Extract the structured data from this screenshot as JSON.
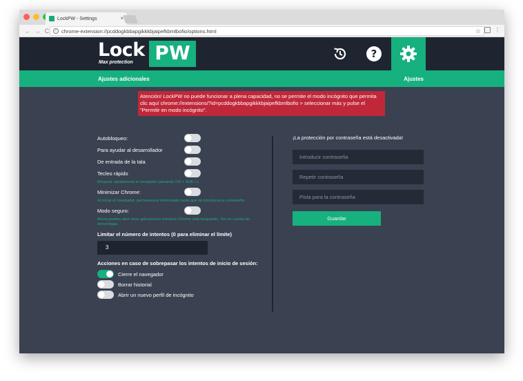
{
  "browser": {
    "tab_title": "LockPW - Settings",
    "tab_close": "×",
    "url": "chrome-extension://pcddogkbbapgikkkbjaipefkbmlbofio/options.html",
    "info": "i",
    "star": "☆",
    "menu": "⋮",
    "nav": {
      "back": "←",
      "forward": "→",
      "reload": "C"
    }
  },
  "header": {
    "logo_main": "Lock",
    "logo_sub": "Max protection",
    "logo_badge": "PW",
    "icons": [
      "history-icon",
      "help-icon",
      "settings-icon"
    ],
    "help_glyph": "?"
  },
  "greenbar": {
    "left": "Ajustes adicionales",
    "right": "Ajustes"
  },
  "alert": {
    "text": "Atención! LockPW no puede funcionar a plena capacidad, no se permite el modo incógnito que permita clic aquí chrome://extensions/?id=pcddogkbbapgikkkbjaipefkbmlbofio > seleccionar más y pulse el \"Permitir en modo incógnito\"."
  },
  "settings": [
    {
      "label": "Autobloqueo:",
      "on": false
    },
    {
      "label": "Para ayudar al desarrollador",
      "on": false
    },
    {
      "label": "De entrada de la tala",
      "on": false
    },
    {
      "label": "Tecleo rápido",
      "on": false,
      "hint": "Bloquear rápidamente el navegador pulsando Ctrl + Shift + L"
    },
    {
      "label": "Minimizar Chrome:",
      "on": false,
      "hint": "Al iniciar el navegador, permanecerá minimizado hasta que se introduzca la contraseña."
    },
    {
      "label": "Modo seguro:",
      "on": false,
      "hint": "Ahora puedes abrir otras aplicaciones mientras Chrome está bloqueado. Ten en cuenta las desventajas."
    }
  ],
  "limit": {
    "label": "Limitar el número de intentos (0 para eliminar el límite)",
    "value": "3"
  },
  "actions": {
    "label": "Acciones en caso de sobrepasar los intentos de inicio de sesión:",
    "items": [
      {
        "label": "Cierre el navegador",
        "on": true
      },
      {
        "label": "Borrar historial",
        "on": false
      },
      {
        "label": "Abrir un nuevo perfil de incógnito",
        "on": false
      }
    ]
  },
  "password": {
    "status": "¡La protección por contraseña está desactivada!",
    "field1_placeholder": "Introducir contraseña",
    "field2_placeholder": "Repetir contraseña",
    "field3_placeholder": "Pista para la contraseña",
    "save_label": "Guardar"
  },
  "colors": {
    "accent": "#17b07f",
    "alert": "#c0283a",
    "background": "#3a4150",
    "header": "#1f2530"
  }
}
